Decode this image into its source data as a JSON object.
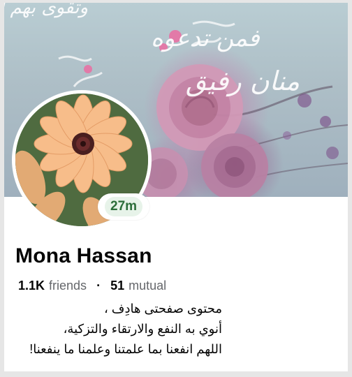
{
  "profile": {
    "name": "Mona Hassan",
    "status_badge": "27m",
    "friends_count": "1.1K",
    "friends_label": "friends",
    "mutual_count": "51",
    "mutual_label": "mutual",
    "bio_lines": [
      "محتوى صفحتى هادِف ،",
      "أنوي به النفع والارتقاء والتزكية،",
      "اللهم انفعنا بما علمتنا وعلمنا ما ينفعنا!"
    ]
  },
  "cover": {
    "calligraphy_lines": [
      "فمن تدعوه",
      "منان رفيق"
    ]
  },
  "colors": {
    "status_green": "#2c6e3a",
    "status_bg": "#e7f3e9",
    "secondary_text": "#65676b",
    "primary_text": "#050505"
  }
}
